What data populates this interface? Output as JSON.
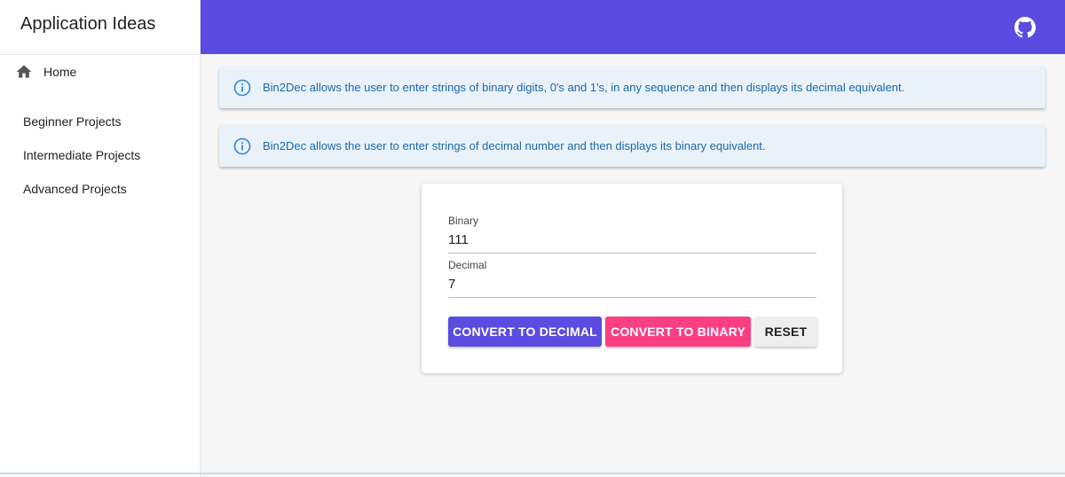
{
  "app": {
    "title": "Application Ideas"
  },
  "colors": {
    "topbar": "#5a4ce1",
    "accent_pink": "#fb3f82",
    "info_text": "#1c6aa8"
  },
  "sidebar": {
    "home": {
      "label": "Home",
      "icon": "home-icon"
    },
    "items": [
      {
        "label": "Beginner Projects"
      },
      {
        "label": "Intermediate Projects"
      },
      {
        "label": "Advanced Projects"
      }
    ]
  },
  "topbar": {
    "icon": "github-icon"
  },
  "alerts": [
    {
      "icon": "info-icon",
      "text": "Bin2Dec allows the user to enter strings of binary digits, 0's and 1's, in any sequence and then displays its decimal equivalent."
    },
    {
      "icon": "info-icon",
      "text": "Bin2Dec allows the user to enter strings of decimal number and then displays its binary equivalent."
    }
  ],
  "converter": {
    "binary": {
      "label": "Binary",
      "value": "111"
    },
    "decimal": {
      "label": "Decimal",
      "value": "7"
    },
    "buttons": {
      "to_decimal": "CONVERT TO DECIMAL",
      "to_binary": "CONVERT TO BINARY",
      "reset": "RESET"
    }
  }
}
